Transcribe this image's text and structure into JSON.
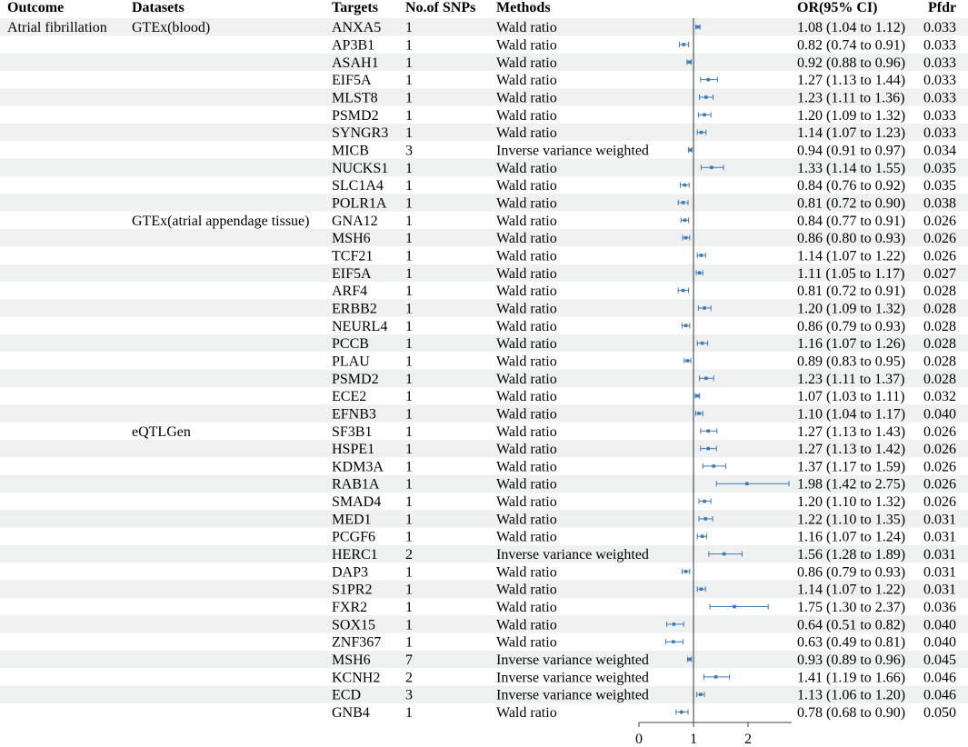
{
  "chart_data": {
    "type": "forest",
    "headers": {
      "outcome": "Outcome",
      "datasets": "Datasets",
      "targets": "Targets",
      "snps": "No.of SNPs",
      "methods": "Methods",
      "or": "OR(95% CI)",
      "pfdr": "Pfdr"
    },
    "x_ticks": [
      "0",
      "1",
      "2"
    ],
    "x_tick_values": [
      0,
      1,
      2
    ],
    "x_range": [
      0,
      2.8
    ],
    "reference_line": 1,
    "colors": {
      "stripe": "#eef1f0",
      "marker": "#3f79b8",
      "refline": "#333333"
    },
    "rows": [
      {
        "outcome": "Atrial fibrillation",
        "dataset": "GTEx(blood)",
        "target": "ANXA5",
        "snps": "1",
        "method": "Wald ratio",
        "or_text": "1.08 (1.04 to 1.12)",
        "or": 1.08,
        "lo": 1.04,
        "hi": 1.12,
        "pfdr": "0.033"
      },
      {
        "outcome": "",
        "dataset": "",
        "target": "AP3B1",
        "snps": "1",
        "method": "Wald ratio",
        "or_text": "0.82 (0.74 to 0.91)",
        "or": 0.82,
        "lo": 0.74,
        "hi": 0.91,
        "pfdr": "0.033"
      },
      {
        "outcome": "",
        "dataset": "",
        "target": "ASAH1",
        "snps": "1",
        "method": "Wald ratio",
        "or_text": "0.92 (0.88 to 0.96)",
        "or": 0.92,
        "lo": 0.88,
        "hi": 0.96,
        "pfdr": "0.033"
      },
      {
        "outcome": "",
        "dataset": "",
        "target": "EIF5A",
        "snps": "1",
        "method": "Wald ratio",
        "or_text": "1.27 (1.13 to 1.44)",
        "or": 1.27,
        "lo": 1.13,
        "hi": 1.44,
        "pfdr": "0.033"
      },
      {
        "outcome": "",
        "dataset": "",
        "target": "MLST8",
        "snps": "1",
        "method": "Wald ratio",
        "or_text": "1.23 (1.11 to 1.36)",
        "or": 1.23,
        "lo": 1.11,
        "hi": 1.36,
        "pfdr": "0.033"
      },
      {
        "outcome": "",
        "dataset": "",
        "target": "PSMD2",
        "snps": "1",
        "method": "Wald ratio",
        "or_text": "1.20 (1.09 to 1.32)",
        "or": 1.2,
        "lo": 1.09,
        "hi": 1.32,
        "pfdr": "0.033"
      },
      {
        "outcome": "",
        "dataset": "",
        "target": "SYNGR3",
        "snps": "1",
        "method": "Wald ratio",
        "or_text": "1.14 (1.07 to 1.23)",
        "or": 1.14,
        "lo": 1.07,
        "hi": 1.23,
        "pfdr": "0.033"
      },
      {
        "outcome": "",
        "dataset": "",
        "target": "MICB",
        "snps": "3",
        "method": "Inverse variance weighted",
        "or_text": "0.94 (0.91 to 0.97)",
        "or": 0.94,
        "lo": 0.91,
        "hi": 0.97,
        "pfdr": "0.034"
      },
      {
        "outcome": "",
        "dataset": "",
        "target": "NUCKS1",
        "snps": "1",
        "method": "Wald ratio",
        "or_text": "1.33 (1.14 to 1.55)",
        "or": 1.33,
        "lo": 1.14,
        "hi": 1.55,
        "pfdr": "0.035"
      },
      {
        "outcome": "",
        "dataset": "",
        "target": "SLC1A4",
        "snps": "1",
        "method": "Wald ratio",
        "or_text": "0.84 (0.76 to 0.92)",
        "or": 0.84,
        "lo": 0.76,
        "hi": 0.92,
        "pfdr": "0.035"
      },
      {
        "outcome": "",
        "dataset": "",
        "target": "POLR1A",
        "snps": "1",
        "method": "Wald ratio",
        "or_text": "0.81 (0.72 to 0.90)",
        "or": 0.81,
        "lo": 0.72,
        "hi": 0.9,
        "pfdr": "0.038"
      },
      {
        "outcome": "",
        "dataset": "GTEx(atrial appendage tissue)",
        "target": "GNA12",
        "snps": "1",
        "method": "Wald ratio",
        "or_text": "0.84 (0.77 to 0.91)",
        "or": 0.84,
        "lo": 0.77,
        "hi": 0.91,
        "pfdr": "0.026"
      },
      {
        "outcome": "",
        "dataset": "",
        "target": "MSH6",
        "snps": "1",
        "method": "Wald ratio",
        "or_text": "0.86 (0.80 to 0.93)",
        "or": 0.86,
        "lo": 0.8,
        "hi": 0.93,
        "pfdr": "0.026"
      },
      {
        "outcome": "",
        "dataset": "",
        "target": "TCF21",
        "snps": "1",
        "method": "Wald ratio",
        "or_text": "1.14 (1.07 to 1.22)",
        "or": 1.14,
        "lo": 1.07,
        "hi": 1.22,
        "pfdr": "0.026"
      },
      {
        "outcome": "",
        "dataset": "",
        "target": "EIF5A",
        "snps": "1",
        "method": "Wald ratio",
        "or_text": "1.11 (1.05 to 1.17)",
        "or": 1.11,
        "lo": 1.05,
        "hi": 1.17,
        "pfdr": "0.027"
      },
      {
        "outcome": "",
        "dataset": "",
        "target": "ARF4",
        "snps": "1",
        "method": "Wald ratio",
        "or_text": "0.81 (0.72 to 0.91)",
        "or": 0.81,
        "lo": 0.72,
        "hi": 0.91,
        "pfdr": "0.028"
      },
      {
        "outcome": "",
        "dataset": "",
        "target": "ERBB2",
        "snps": "1",
        "method": "Wald ratio",
        "or_text": "1.20 (1.09 to 1.32)",
        "or": 1.2,
        "lo": 1.09,
        "hi": 1.32,
        "pfdr": "0.028"
      },
      {
        "outcome": "",
        "dataset": "",
        "target": "NEURL4",
        "snps": "1",
        "method": "Wald ratio",
        "or_text": "0.86 (0.79 to 0.93)",
        "or": 0.86,
        "lo": 0.79,
        "hi": 0.93,
        "pfdr": "0.028"
      },
      {
        "outcome": "",
        "dataset": "",
        "target": "PCCB",
        "snps": "1",
        "method": "Wald ratio",
        "or_text": "1.16 (1.07 to 1.26)",
        "or": 1.16,
        "lo": 1.07,
        "hi": 1.26,
        "pfdr": "0.028"
      },
      {
        "outcome": "",
        "dataset": "",
        "target": "PLAU",
        "snps": "1",
        "method": "Wald ratio",
        "or_text": "0.89 (0.83 to 0.95)",
        "or": 0.89,
        "lo": 0.83,
        "hi": 0.95,
        "pfdr": "0.028"
      },
      {
        "outcome": "",
        "dataset": "",
        "target": "PSMD2",
        "snps": "1",
        "method": "Wald ratio",
        "or_text": "1.23 (1.11 to 1.37)",
        "or": 1.23,
        "lo": 1.11,
        "hi": 1.37,
        "pfdr": "0.028"
      },
      {
        "outcome": "",
        "dataset": "",
        "target": "ECE2",
        "snps": "1",
        "method": "Wald ratio",
        "or_text": "1.07 (1.03 to 1.11)",
        "or": 1.07,
        "lo": 1.03,
        "hi": 1.11,
        "pfdr": "0.032"
      },
      {
        "outcome": "",
        "dataset": "",
        "target": "EFNB3",
        "snps": "1",
        "method": "Wald ratio",
        "or_text": "1.10 (1.04 to 1.17)",
        "or": 1.1,
        "lo": 1.04,
        "hi": 1.17,
        "pfdr": "0.040"
      },
      {
        "outcome": "",
        "dataset": "eQTLGen",
        "target": "SF3B1",
        "snps": "1",
        "method": "Wald ratio",
        "or_text": "1.27 (1.13 to 1.43)",
        "or": 1.27,
        "lo": 1.13,
        "hi": 1.43,
        "pfdr": "0.026"
      },
      {
        "outcome": "",
        "dataset": "",
        "target": "HSPE1",
        "snps": "1",
        "method": "Wald ratio",
        "or_text": "1.27 (1.13 to 1.42)",
        "or": 1.27,
        "lo": 1.13,
        "hi": 1.42,
        "pfdr": "0.026"
      },
      {
        "outcome": "",
        "dataset": "",
        "target": "KDM3A",
        "snps": "1",
        "method": "Wald ratio",
        "or_text": "1.37 (1.17 to 1.59)",
        "or": 1.37,
        "lo": 1.17,
        "hi": 1.59,
        "pfdr": "0.026"
      },
      {
        "outcome": "",
        "dataset": "",
        "target": "RAB1A",
        "snps": "1",
        "method": "Wald ratio",
        "or_text": "1.98 (1.42 to 2.75)",
        "or": 1.98,
        "lo": 1.42,
        "hi": 2.75,
        "pfdr": "0.026"
      },
      {
        "outcome": "",
        "dataset": "",
        "target": "SMAD4",
        "snps": "1",
        "method": "Wald ratio",
        "or_text": "1.20 (1.10 to 1.32)",
        "or": 1.2,
        "lo": 1.1,
        "hi": 1.32,
        "pfdr": "0.026"
      },
      {
        "outcome": "",
        "dataset": "",
        "target": "MED1",
        "snps": "1",
        "method": "Wald ratio",
        "or_text": "1.22 (1.10 to 1.35)",
        "or": 1.22,
        "lo": 1.1,
        "hi": 1.35,
        "pfdr": "0.031"
      },
      {
        "outcome": "",
        "dataset": "",
        "target": "PCGF6",
        "snps": "1",
        "method": "Wald ratio",
        "or_text": "1.16 (1.07 to 1.24)",
        "or": 1.16,
        "lo": 1.07,
        "hi": 1.24,
        "pfdr": "0.031"
      },
      {
        "outcome": "",
        "dataset": "",
        "target": "HERC1",
        "snps": "2",
        "method": "Inverse variance weighted",
        "or_text": "1.56 (1.28 to 1.89)",
        "or": 1.56,
        "lo": 1.28,
        "hi": 1.89,
        "pfdr": "0.031"
      },
      {
        "outcome": "",
        "dataset": "",
        "target": "DAP3",
        "snps": "1",
        "method": "Wald ratio",
        "or_text": "0.86 (0.79 to 0.93)",
        "or": 0.86,
        "lo": 0.79,
        "hi": 0.93,
        "pfdr": "0.031"
      },
      {
        "outcome": "",
        "dataset": "",
        "target": "S1PR2",
        "snps": "1",
        "method": "Wald ratio",
        "or_text": "1.14 (1.07 to 1.22)",
        "or": 1.14,
        "lo": 1.07,
        "hi": 1.22,
        "pfdr": "0.031"
      },
      {
        "outcome": "",
        "dataset": "",
        "target": "FXR2",
        "snps": "1",
        "method": "Wald ratio",
        "or_text": "1.75 (1.30 to 2.37)",
        "or": 1.75,
        "lo": 1.3,
        "hi": 2.37,
        "pfdr": "0.036"
      },
      {
        "outcome": "",
        "dataset": "",
        "target": "SOX15",
        "snps": "1",
        "method": "Wald ratio",
        "or_text": "0.64 (0.51 to 0.82)",
        "or": 0.64,
        "lo": 0.51,
        "hi": 0.82,
        "pfdr": "0.040"
      },
      {
        "outcome": "",
        "dataset": "",
        "target": "ZNF367",
        "snps": "1",
        "method": "Wald ratio",
        "or_text": "0.63 (0.49 to 0.81)",
        "or": 0.63,
        "lo": 0.49,
        "hi": 0.81,
        "pfdr": "0.040"
      },
      {
        "outcome": "",
        "dataset": "",
        "target": "MSH6",
        "snps": "7",
        "method": "Inverse variance weighted",
        "or_text": "0.93 (0.89 to 0.96)",
        "or": 0.93,
        "lo": 0.89,
        "hi": 0.96,
        "pfdr": "0.045"
      },
      {
        "outcome": "",
        "dataset": "",
        "target": "KCNH2",
        "snps": "2",
        "method": "Inverse variance weighted",
        "or_text": "1.41 (1.19 to 1.66)",
        "or": 1.41,
        "lo": 1.19,
        "hi": 1.66,
        "pfdr": "0.046"
      },
      {
        "outcome": "",
        "dataset": "",
        "target": "ECD",
        "snps": "3",
        "method": "Inverse variance weighted",
        "or_text": "1.13 (1.06 to 1.20)",
        "or": 1.13,
        "lo": 1.06,
        "hi": 1.2,
        "pfdr": "0.046"
      },
      {
        "outcome": "",
        "dataset": "",
        "target": "GNB4",
        "snps": "1",
        "method": "Wald ratio",
        "or_text": "0.78 (0.68 to 0.90)",
        "or": 0.78,
        "lo": 0.68,
        "hi": 0.9,
        "pfdr": "0.050"
      }
    ]
  }
}
